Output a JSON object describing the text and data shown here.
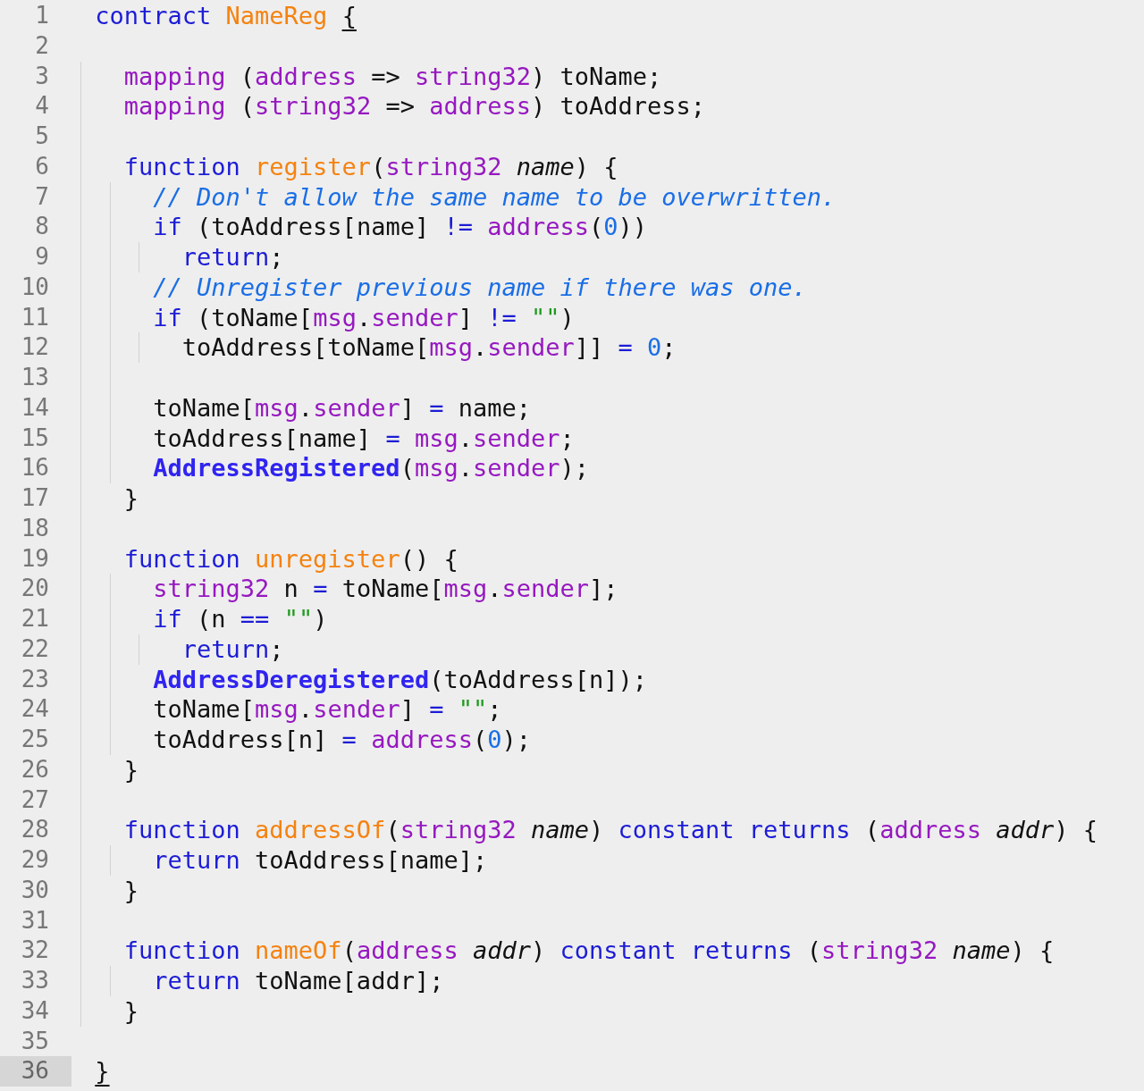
{
  "editor": {
    "lines": [
      {
        "number": "1",
        "current": false,
        "tokens": [
          {
            "kind": "kw",
            "text": "contract "
          },
          {
            "kind": "fn",
            "text": "NameReg "
          },
          {
            "kind": "match",
            "text": "{"
          }
        ]
      },
      {
        "number": "2",
        "current": false
      },
      {
        "number": "3",
        "current": false,
        "tokens": [
          {
            "kind": "type",
            "text": "  mapping"
          },
          {
            "kind": "plain",
            "text": " ("
          },
          {
            "kind": "type",
            "text": "address"
          },
          {
            "kind": "plain",
            "text": " => "
          },
          {
            "kind": "type",
            "text": "string32"
          },
          {
            "kind": "plain",
            "text": ") toName;"
          }
        ]
      },
      {
        "number": "4",
        "current": false,
        "tokens": [
          {
            "kind": "type",
            "text": "  mapping"
          },
          {
            "kind": "plain",
            "text": " ("
          },
          {
            "kind": "type",
            "text": "string32"
          },
          {
            "kind": "plain",
            "text": " => "
          },
          {
            "kind": "type",
            "text": "address"
          },
          {
            "kind": "plain",
            "text": ") toAddress;"
          }
        ]
      },
      {
        "number": "5",
        "current": false
      },
      {
        "number": "6",
        "current": false,
        "tokens": [
          {
            "kind": "kw",
            "text": "  function "
          },
          {
            "kind": "fn",
            "text": "register"
          },
          {
            "kind": "plain",
            "text": "("
          },
          {
            "kind": "type",
            "text": "string32 "
          },
          {
            "kind": "param",
            "text": "name"
          },
          {
            "kind": "plain",
            "text": ") {"
          }
        ]
      },
      {
        "number": "7",
        "current": false,
        "tokens": [
          {
            "kind": "comment",
            "text": "    // Don't allow the same name to be overwritten."
          }
        ]
      },
      {
        "number": "8",
        "current": false,
        "tokens": [
          {
            "kind": "kw",
            "text": "    if"
          },
          {
            "kind": "plain",
            "text": " (toAddress[name] "
          },
          {
            "kind": "op",
            "text": "!= "
          },
          {
            "kind": "type",
            "text": "address"
          },
          {
            "kind": "plain",
            "text": "("
          },
          {
            "kind": "num",
            "text": "0"
          },
          {
            "kind": "plain",
            "text": "))"
          }
        ]
      },
      {
        "number": "9",
        "current": false,
        "tokens": [
          {
            "kind": "kw",
            "text": "      return"
          },
          {
            "kind": "plain",
            "text": ";"
          }
        ]
      },
      {
        "number": "10",
        "current": false,
        "tokens": [
          {
            "kind": "comment",
            "text": "    // Unregister previous name if there was one."
          }
        ]
      },
      {
        "number": "11",
        "current": false,
        "tokens": [
          {
            "kind": "kw",
            "text": "    if"
          },
          {
            "kind": "plain",
            "text": " (toName["
          },
          {
            "kind": "type",
            "text": "msg"
          },
          {
            "kind": "plain",
            "text": "."
          },
          {
            "kind": "type",
            "text": "sender"
          },
          {
            "kind": "plain",
            "text": "] "
          },
          {
            "kind": "op",
            "text": "!= "
          },
          {
            "kind": "str",
            "text": "\"\""
          },
          {
            "kind": "plain",
            "text": ")"
          }
        ]
      },
      {
        "number": "12",
        "current": false,
        "tokens": [
          {
            "kind": "plain",
            "text": "      toAddress[toName["
          },
          {
            "kind": "type",
            "text": "msg"
          },
          {
            "kind": "plain",
            "text": "."
          },
          {
            "kind": "type",
            "text": "sender"
          },
          {
            "kind": "plain",
            "text": "]] "
          },
          {
            "kind": "op",
            "text": "= "
          },
          {
            "kind": "num",
            "text": "0"
          },
          {
            "kind": "plain",
            "text": ";"
          }
        ]
      },
      {
        "number": "13",
        "current": false
      },
      {
        "number": "14",
        "current": false,
        "tokens": [
          {
            "kind": "plain",
            "text": "    toName["
          },
          {
            "kind": "type",
            "text": "msg"
          },
          {
            "kind": "plain",
            "text": "."
          },
          {
            "kind": "type",
            "text": "sender"
          },
          {
            "kind": "plain",
            "text": "] "
          },
          {
            "kind": "op",
            "text": "="
          },
          {
            "kind": "plain",
            "text": " name;"
          }
        ]
      },
      {
        "number": "15",
        "current": false,
        "tokens": [
          {
            "kind": "plain",
            "text": "    toAddress[name] "
          },
          {
            "kind": "op",
            "text": "= "
          },
          {
            "kind": "type",
            "text": "msg"
          },
          {
            "kind": "plain",
            "text": "."
          },
          {
            "kind": "type",
            "text": "sender"
          },
          {
            "kind": "plain",
            "text": ";"
          }
        ]
      },
      {
        "number": "16",
        "current": false,
        "tokens": [
          {
            "kind": "event",
            "text": "    AddressRegistered"
          },
          {
            "kind": "plain",
            "text": "("
          },
          {
            "kind": "type",
            "text": "msg"
          },
          {
            "kind": "plain",
            "text": "."
          },
          {
            "kind": "type",
            "text": "sender"
          },
          {
            "kind": "plain",
            "text": ");"
          }
        ]
      },
      {
        "number": "17",
        "current": false,
        "tokens": [
          {
            "kind": "plain",
            "text": "  }"
          }
        ]
      },
      {
        "number": "18",
        "current": false
      },
      {
        "number": "19",
        "current": false,
        "tokens": [
          {
            "kind": "kw",
            "text": "  function "
          },
          {
            "kind": "fn",
            "text": "unregister"
          },
          {
            "kind": "plain",
            "text": "() {"
          }
        ]
      },
      {
        "number": "20",
        "current": false,
        "tokens": [
          {
            "kind": "type",
            "text": "    string32"
          },
          {
            "kind": "plain",
            "text": " n "
          },
          {
            "kind": "op",
            "text": "="
          },
          {
            "kind": "plain",
            "text": " toName["
          },
          {
            "kind": "type",
            "text": "msg"
          },
          {
            "kind": "plain",
            "text": "."
          },
          {
            "kind": "type",
            "text": "sender"
          },
          {
            "kind": "plain",
            "text": "];"
          }
        ]
      },
      {
        "number": "21",
        "current": false,
        "tokens": [
          {
            "kind": "kw",
            "text": "    if"
          },
          {
            "kind": "plain",
            "text": " (n "
          },
          {
            "kind": "op",
            "text": "== "
          },
          {
            "kind": "str",
            "text": "\"\""
          },
          {
            "kind": "plain",
            "text": ")"
          }
        ]
      },
      {
        "number": "22",
        "current": false,
        "tokens": [
          {
            "kind": "kw",
            "text": "      return"
          },
          {
            "kind": "plain",
            "text": ";"
          }
        ]
      },
      {
        "number": "23",
        "current": false,
        "tokens": [
          {
            "kind": "event",
            "text": "    AddressDeregistered"
          },
          {
            "kind": "plain",
            "text": "(toAddress[n]);"
          }
        ]
      },
      {
        "number": "24",
        "current": false,
        "tokens": [
          {
            "kind": "plain",
            "text": "    toName["
          },
          {
            "kind": "type",
            "text": "msg"
          },
          {
            "kind": "plain",
            "text": "."
          },
          {
            "kind": "type",
            "text": "sender"
          },
          {
            "kind": "plain",
            "text": "] "
          },
          {
            "kind": "op",
            "text": "= "
          },
          {
            "kind": "str",
            "text": "\"\""
          },
          {
            "kind": "plain",
            "text": ";"
          }
        ]
      },
      {
        "number": "25",
        "current": false,
        "tokens": [
          {
            "kind": "plain",
            "text": "    toAddress[n] "
          },
          {
            "kind": "op",
            "text": "= "
          },
          {
            "kind": "type",
            "text": "address"
          },
          {
            "kind": "plain",
            "text": "("
          },
          {
            "kind": "num",
            "text": "0"
          },
          {
            "kind": "plain",
            "text": ");"
          }
        ]
      },
      {
        "number": "26",
        "current": false,
        "tokens": [
          {
            "kind": "plain",
            "text": "  }"
          }
        ]
      },
      {
        "number": "27",
        "current": false
      },
      {
        "number": "28",
        "current": false,
        "tokens": [
          {
            "kind": "kw",
            "text": "  function "
          },
          {
            "kind": "fn",
            "text": "addressOf"
          },
          {
            "kind": "plain",
            "text": "("
          },
          {
            "kind": "type",
            "text": "string32 "
          },
          {
            "kind": "param",
            "text": "name"
          },
          {
            "kind": "plain",
            "text": ") "
          },
          {
            "kind": "kw",
            "text": "constant returns"
          },
          {
            "kind": "plain",
            "text": " ("
          },
          {
            "kind": "type",
            "text": "address "
          },
          {
            "kind": "param",
            "text": "addr"
          },
          {
            "kind": "plain",
            "text": ") {"
          }
        ]
      },
      {
        "number": "29",
        "current": false,
        "tokens": [
          {
            "kind": "kw",
            "text": "    return"
          },
          {
            "kind": "plain",
            "text": " toAddress[name];"
          }
        ]
      },
      {
        "number": "30",
        "current": false,
        "tokens": [
          {
            "kind": "plain",
            "text": "  }"
          }
        ]
      },
      {
        "number": "31",
        "current": false
      },
      {
        "number": "32",
        "current": false,
        "tokens": [
          {
            "kind": "kw",
            "text": "  function "
          },
          {
            "kind": "fn",
            "text": "nameOf"
          },
          {
            "kind": "plain",
            "text": "("
          },
          {
            "kind": "type",
            "text": "address "
          },
          {
            "kind": "param",
            "text": "addr"
          },
          {
            "kind": "plain",
            "text": ") "
          },
          {
            "kind": "kw",
            "text": "constant returns"
          },
          {
            "kind": "plain",
            "text": " ("
          },
          {
            "kind": "type",
            "text": "string32 "
          },
          {
            "kind": "param",
            "text": "name"
          },
          {
            "kind": "plain",
            "text": ") {"
          }
        ]
      },
      {
        "number": "33",
        "current": false,
        "tokens": [
          {
            "kind": "kw",
            "text": "    return"
          },
          {
            "kind": "plain",
            "text": " toName[addr];"
          }
        ]
      },
      {
        "number": "34",
        "current": false,
        "tokens": [
          {
            "kind": "plain",
            "text": "  }"
          }
        ]
      },
      {
        "number": "35",
        "current": false
      },
      {
        "number": "36",
        "current": true,
        "tokens": [
          {
            "kind": "match",
            "text": "}"
          }
        ]
      }
    ]
  }
}
